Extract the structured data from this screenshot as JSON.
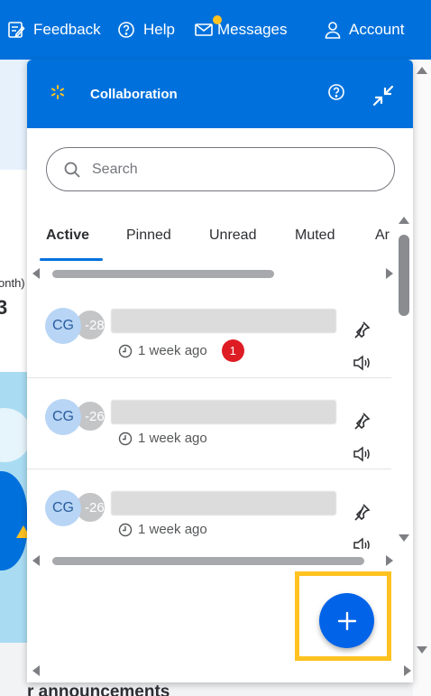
{
  "nav": {
    "feedback": "Feedback",
    "help": "Help",
    "messages": "Messages",
    "account": "Account"
  },
  "background": {
    "month_text": "onth)",
    "number_text": "3",
    "announcement_text": "r announcements"
  },
  "panel": {
    "title": "Collaboration",
    "search": {
      "placeholder": "Search"
    },
    "tabs": [
      {
        "label": "Active",
        "active": true
      },
      {
        "label": "Pinned",
        "active": false
      },
      {
        "label": "Unread",
        "active": false
      },
      {
        "label": "Muted",
        "active": false
      },
      {
        "label": "Ar",
        "active": false
      }
    ],
    "conversations": [
      {
        "initials": "CG",
        "secondary_avatar": "-28",
        "time": "1 week ago",
        "unread": "1"
      },
      {
        "initials": "CG",
        "secondary_avatar": "-26",
        "time": "1 week ago",
        "unread": ""
      },
      {
        "initials": "CG",
        "secondary_avatar": "-26",
        "time": "1 week ago",
        "unread": ""
      }
    ]
  },
  "colors": {
    "brand_blue": "#0071dc",
    "highlight_yellow": "#ffc220",
    "badge_red": "#de1c24",
    "fab_blue": "#0063e8"
  },
  "icons": [
    "feedback-icon",
    "help-icon",
    "mail-icon",
    "user-icon",
    "spark-icon",
    "collapse-icon",
    "search-icon",
    "clock-icon",
    "pin-icon",
    "speaker-icon",
    "plus-icon"
  ]
}
